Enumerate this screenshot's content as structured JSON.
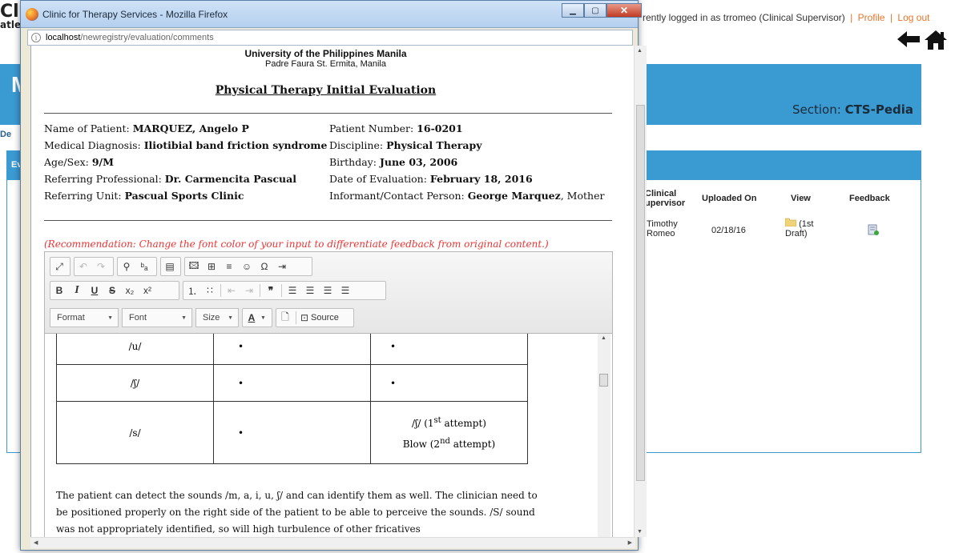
{
  "background": {
    "brand": [
      "Cli",
      "atle"
    ],
    "login_prefix": "rently logged in as trromeo (Clinical Supervisor)",
    "profile": "Profile",
    "separator": "|",
    "logout": "Log out",
    "banner_letter": "M",
    "section_prefix": "Section:",
    "section_value": "CTS-Pedia",
    "de": "De",
    "ev": "Ev",
    "table": {
      "headers": [
        "Clinical\nupervisor",
        "Uploaded On",
        "View",
        "Feedback"
      ],
      "row": {
        "supervisor": "Timothy\nRomeo",
        "uploaded": "02/18/16",
        "view": "(1st\nDraft)"
      }
    }
  },
  "popup": {
    "title": "Clinic for Therapy Services - Mozilla Firefox",
    "url_host": "localhost",
    "url_path": "/newregistry/evaluation/comments",
    "university": "University of the Philippines Manila",
    "address": "Padre Faura St. Ermita, Manila",
    "doc_title": "Physical Therapy Initial Evaluation",
    "info_left": [
      {
        "label": "Name of Patient: ",
        "value": "MARQUEZ, Angelo P"
      },
      {
        "label": "Medical Diagnosis: ",
        "value": "Iliotibial band friction syndrome"
      },
      {
        "label": "Age/Sex: ",
        "value": "9/M"
      },
      {
        "label": "Referring Professional: ",
        "value": "Dr. Carmencita Pascual"
      },
      {
        "label": "Referring Unit: ",
        "value": "Pascual Sports Clinic"
      }
    ],
    "info_right": [
      {
        "label": "Patient Number: ",
        "value": "16-0201",
        "suffix": ""
      },
      {
        "label": "Discipline: ",
        "value": "Physical Therapy",
        "suffix": ""
      },
      {
        "label": "Birthday: ",
        "value": "June 03, 2006",
        "suffix": ""
      },
      {
        "label": "Date of Evaluation: ",
        "value": "February 18, 2016",
        "suffix": ""
      },
      {
        "label": "Informant/Contact Person: ",
        "value": "George Marquez",
        "suffix": ", Mother"
      }
    ],
    "recommendation": "(Recommendation: Change the font color of your input to differentiate feedback from original content.)",
    "toolbar": {
      "format": "Format",
      "font": "Font",
      "size": "Size",
      "source": "Source"
    },
    "editor_table": [
      {
        "sound": "/u/",
        "c2": "•",
        "c3": "•"
      },
      {
        "sound": "/ʃ/",
        "c2": "•",
        "c3": "•"
      },
      {
        "sound": "/s/",
        "c2": "•",
        "c3a": "/ʃ/ (1",
        "c3a_sup": "st",
        "c3a_end": " attempt)",
        "c3b": "Blow (2",
        "c3b_sup": "nd",
        "c3b_end": " attempt)"
      }
    ],
    "paragraph": "The patient can detect the sounds /m, a, i, u, ʃ/ and can identify them as well. The clinician need to be positioned properly on the right side of the patient to be able to perceive the sounds. /S/ sound was not appropriately identified, so will high turbulence of other fricatives"
  }
}
